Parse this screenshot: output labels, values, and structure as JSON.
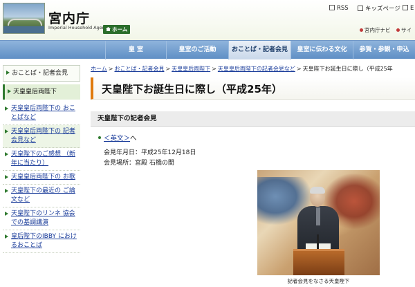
{
  "header": {
    "site_title": "宮内庁",
    "site_subtitle": "Imperial Household Agency",
    "home_button": "ホーム",
    "utility": {
      "rss": "RSS",
      "kids": "キッズページ",
      "english": "E",
      "navi": "宮内庁ナビ",
      "sitemap": "サイ"
    }
  },
  "nav": {
    "items": [
      "皇 室",
      "皇室のご活動",
      "おことば・記者会見",
      "皇室に伝わる文化",
      "参賀・参観・申込"
    ],
    "active_index": 2
  },
  "sidebar": {
    "top_link": "おことば・記者会見",
    "current": "天皇皇后両陛下",
    "items": [
      "天皇皇后両陛下の おことばなど",
      "天皇皇后両陛下の 記者会見など",
      "天皇陛下のご感想 （新年に当たり）",
      "天皇皇后両陛下の お歌",
      "天皇陛下の最近の ご論文など",
      "天皇陛下のリンネ 協会での基調講演",
      "皇后陛下のIBBY におけるおことば"
    ]
  },
  "breadcrumb": {
    "items": [
      "ホーム",
      "おことば・記者会見",
      "天皇皇后両陛下",
      "天皇皇后両陛下の記者会見など"
    ],
    "current": "天皇陛下お誕生日に際し（平成25年"
  },
  "page": {
    "title": "天皇陛下お誕生日に際し（平成25年）",
    "section_heading": "天皇陛下の記者会見",
    "english_link": "＜英文＞",
    "english_suffix": "へ",
    "date_line": "会見年月日：平成25年12月18日",
    "place_line": "会見場所：宮殿 石橋の間",
    "photo_caption": "記者会見をなさる天皇陛下"
  },
  "colors": {
    "nav_blue": "#5f8fc5",
    "accent_green": "#2f7a2f",
    "title_orange": "#e07a0d",
    "link_blue": "#1a3c9a"
  }
}
